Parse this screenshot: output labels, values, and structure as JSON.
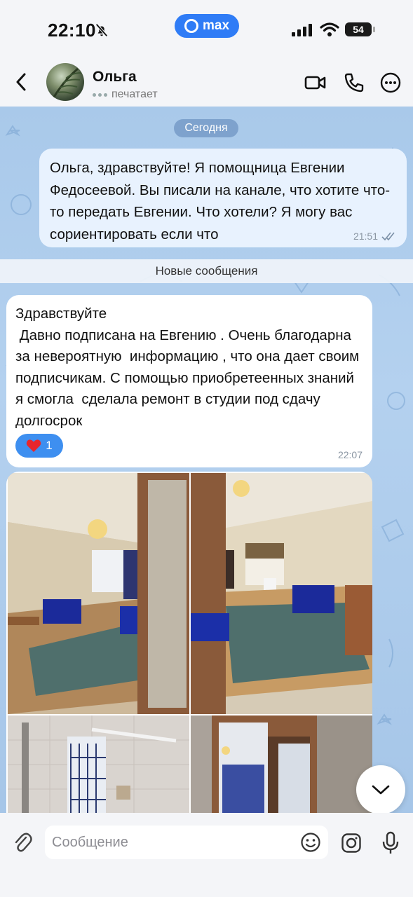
{
  "status_bar": {
    "time": "22:10",
    "app_badge": "max",
    "battery": "54"
  },
  "header": {
    "contact_name": "Ольга",
    "status": "печатает"
  },
  "chat": {
    "date_label": "Сегодня",
    "outgoing": {
      "text": "Ольга, здравствуйте! Я помощница Евгении Федосеевой. Вы писали на канале, что хотите что-то передать Евгении. Что хотели? Я могу вас сориентировать если что",
      "time": "21:51"
    },
    "new_messages_label": "Новые сообщения",
    "incoming": {
      "text": "Здравствуйте\n Давно подписана на Евгению . Очень благодарна за невероятную  информацию , что она дает своим подписчикам. С помощью приобретеенных знаний я смогла  сделала ремонт в студии под сдачу долгосрок",
      "reaction_count": "1",
      "time": "22:07"
    }
  },
  "composer": {
    "placeholder": "Сообщение"
  },
  "colors": {
    "accent": "#2f7cf6",
    "chat_bg": "#a9c9ea",
    "outgoing_bubble": "#e8f2fe",
    "incoming_bubble": "#ffffff"
  },
  "icons": [
    "back-icon",
    "video-call-icon",
    "phone-icon",
    "more-icon",
    "attach-icon",
    "emoji-icon",
    "camera-icon",
    "mic-icon",
    "chevron-down-icon",
    "heart-icon"
  ]
}
